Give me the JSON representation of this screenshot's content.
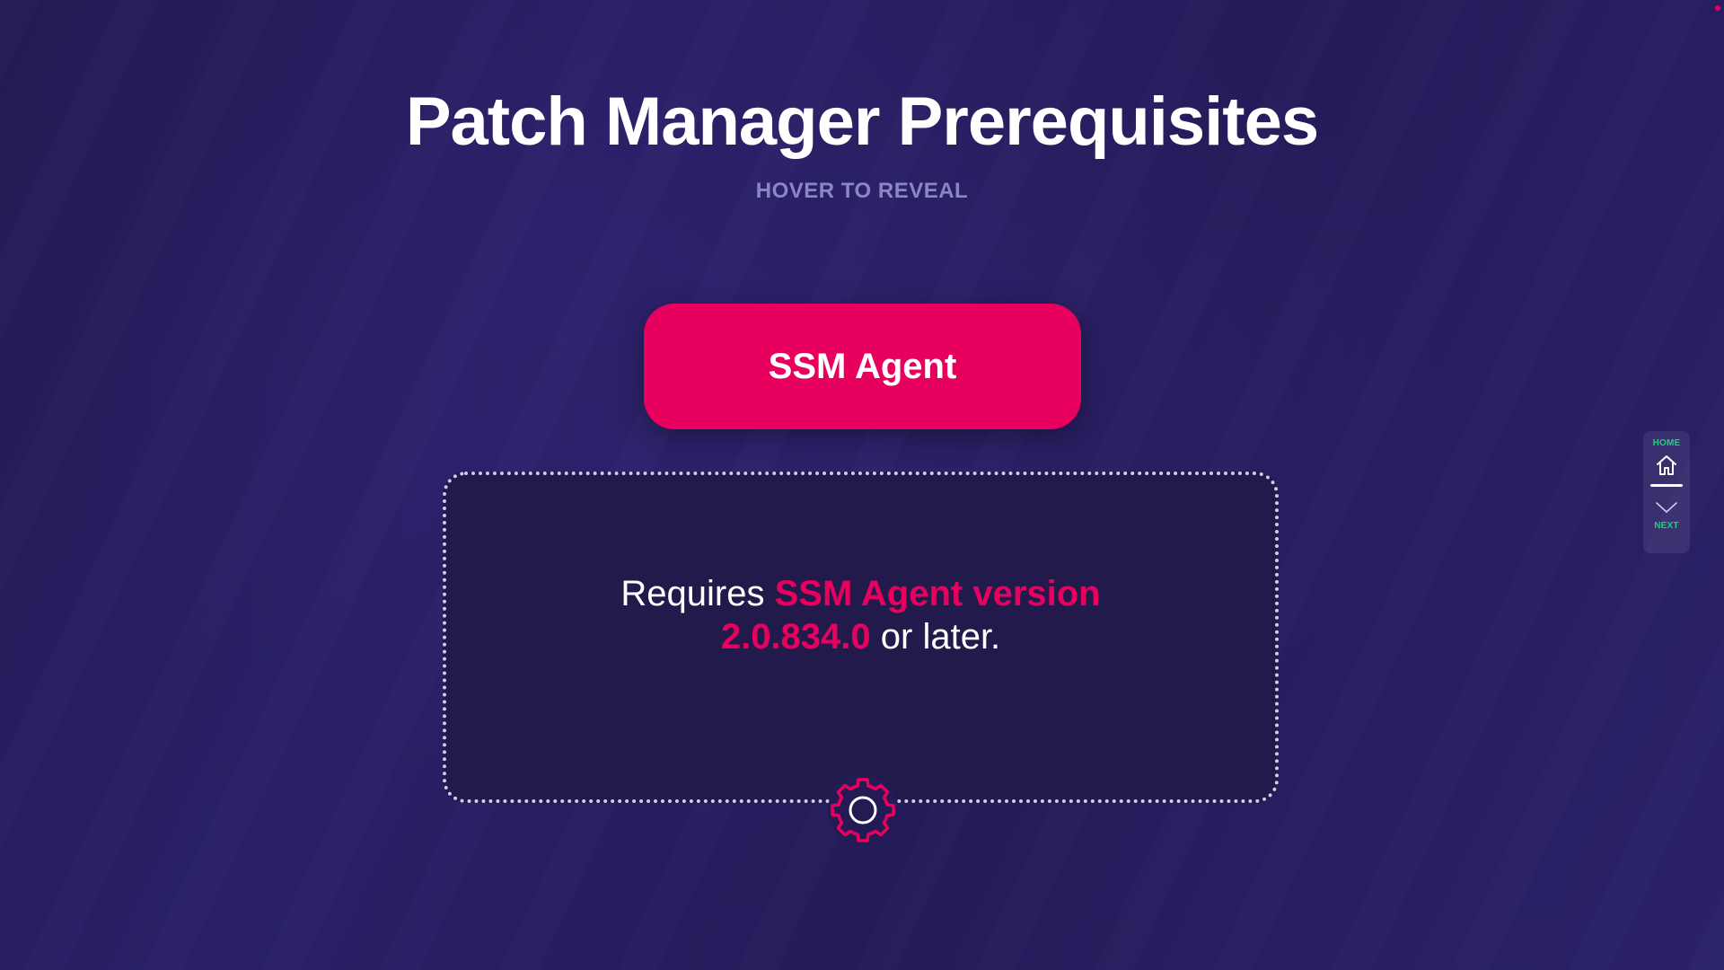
{
  "page": {
    "title": "Patch Manager Prerequisites",
    "subtitle": "HOVER TO REVEAL"
  },
  "card": {
    "button_label": "SSM Agent",
    "text_prefix": "Requires ",
    "text_highlight": "SSM Agent version 2.0.834.0",
    "text_suffix": " or later.",
    "icon": "gear-icon"
  },
  "nav": {
    "home_label": "HOME",
    "home_icon": "home-icon",
    "next_label": "NEXT",
    "next_icon": "chevron-down-icon"
  },
  "colors": {
    "accent": "#e8005f",
    "nav_label": "#21d07a",
    "subtitle": "#8b87c4",
    "background": "#2a2068"
  }
}
